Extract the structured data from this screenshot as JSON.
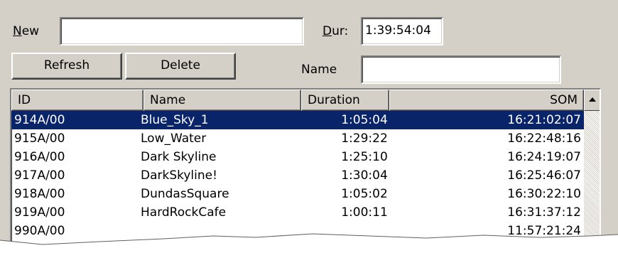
{
  "form": {
    "new_label_mnemonic": "N",
    "new_label_rest": "ew",
    "new_value": "",
    "dur_label_mnemonic": "D",
    "dur_label_rest": "ur:",
    "dur_value": "1:39:54:04",
    "name_label": "Name",
    "name_value": ""
  },
  "buttons": {
    "refresh": "Refresh",
    "delete": "Delete"
  },
  "table": {
    "columns": [
      "ID",
      "Name",
      "Duration",
      "SOM"
    ],
    "rows": [
      {
        "id": "914A/00",
        "name": "Blue_Sky_1",
        "duration": "1:05:04",
        "som": "16:21:02:07",
        "selected": true
      },
      {
        "id": "915A/00",
        "name": "Low_Water",
        "duration": "1:29:22",
        "som": "16:22:48:16"
      },
      {
        "id": "916A/00",
        "name": "Dark Skyline",
        "duration": "1:25:10",
        "som": "16:24:19:07"
      },
      {
        "id": "917A/00",
        "name": "DarkSkyline!",
        "duration": "1:30:04",
        "som": "16:25:46:07"
      },
      {
        "id": "918A/00",
        "name": "DundasSquare",
        "duration": "1:05:02",
        "som": "16:30:22:10"
      },
      {
        "id": "919A/00",
        "name": "HardRockCafe",
        "duration": "1:00:11",
        "som": "16:31:37:12"
      },
      {
        "id": "990A/00",
        "name": "",
        "duration": "",
        "som": "11:57:21:24"
      }
    ]
  },
  "icons": {
    "scroll_up": "triangle-up-icon"
  },
  "colors": {
    "window_bg": "#d4d0c8",
    "selection_bg": "#0a246a",
    "selection_fg": "#ffffff"
  }
}
